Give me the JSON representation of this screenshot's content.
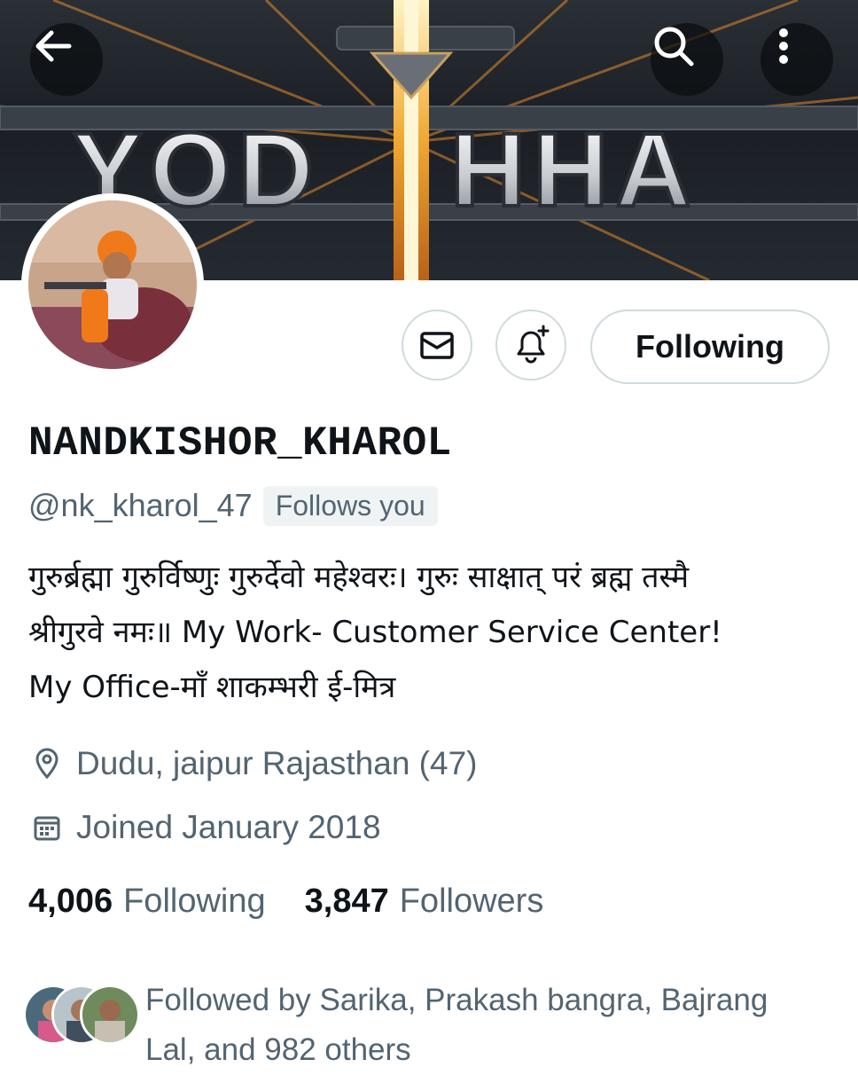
{
  "banner": {
    "title_text": "YODHHA"
  },
  "topbar": {
    "back_icon": "arrow-left-icon",
    "search_icon": "search-icon",
    "more_icon": "more-vertical-icon"
  },
  "actions": {
    "message_icon": "mail-icon",
    "notify_icon": "bell-plus-icon",
    "follow_label": "Following"
  },
  "profile": {
    "display_name": "NANDKISHOR_KHAROL",
    "handle": "@nk_kharol_47",
    "follows_you": "Follows you",
    "bio_lines": [
      "गुरुर्ब्रह्मा गुरुर्विष्णुः गुरुर्देवो महेश्वरः। गुरुः साक्षात् परं ब्रह्म तस्मै",
      "श्रीगुरवे नमः॥ My Work- Customer Service Center!",
      "My Office-माँ शाकम्भरी ई-मित्र"
    ],
    "location": "Dudu, jaipur Rajasthan (47)",
    "joined": "Joined January 2018"
  },
  "stats": {
    "following_count": "4,006",
    "following_label": "Following",
    "followers_count": "3,847",
    "followers_label": "Followers"
  },
  "followed_by": {
    "line1": "Followed by Sarika, Prakash bangra, Bajrang",
    "line2": "Lal, and 982 others"
  },
  "colors": {
    "text_primary": "#0f1419",
    "text_secondary": "#536471",
    "border": "#cfd9de",
    "badge_bg": "#eff3f4"
  }
}
